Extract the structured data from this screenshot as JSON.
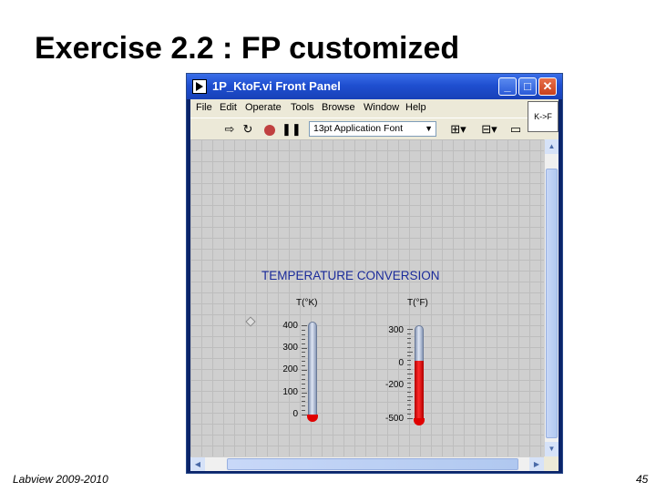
{
  "slide": {
    "title": "Exercise 2.2 : FP customized",
    "footer_left": "Labview 2009-2010",
    "page_number": "45"
  },
  "window": {
    "title": "1P_KtoF.vi Front Panel",
    "icon_label": "K->F",
    "menu": [
      "File",
      "Edit",
      "Operate",
      "Tools",
      "Browse",
      "Window",
      "Help"
    ],
    "font_selector": "13pt Application Font"
  },
  "panel": {
    "heading": "TEMPERATURE CONVERSION",
    "kelvin": {
      "label": "T(°K)",
      "ticks": [
        "400",
        "300",
        "200",
        "100",
        "0"
      ],
      "scale_min": 0,
      "scale_max": 400,
      "value": 0
    },
    "fahrenheit": {
      "label": "T(°F)",
      "ticks": [
        "300",
        "0",
        "-200",
        "-500"
      ],
      "scale_min": -500,
      "scale_max": 300,
      "value": 0
    }
  },
  "colors": {
    "title_bar": "#1f4fd0",
    "heading": "#1a2a9a",
    "mercury": "#e00000"
  }
}
